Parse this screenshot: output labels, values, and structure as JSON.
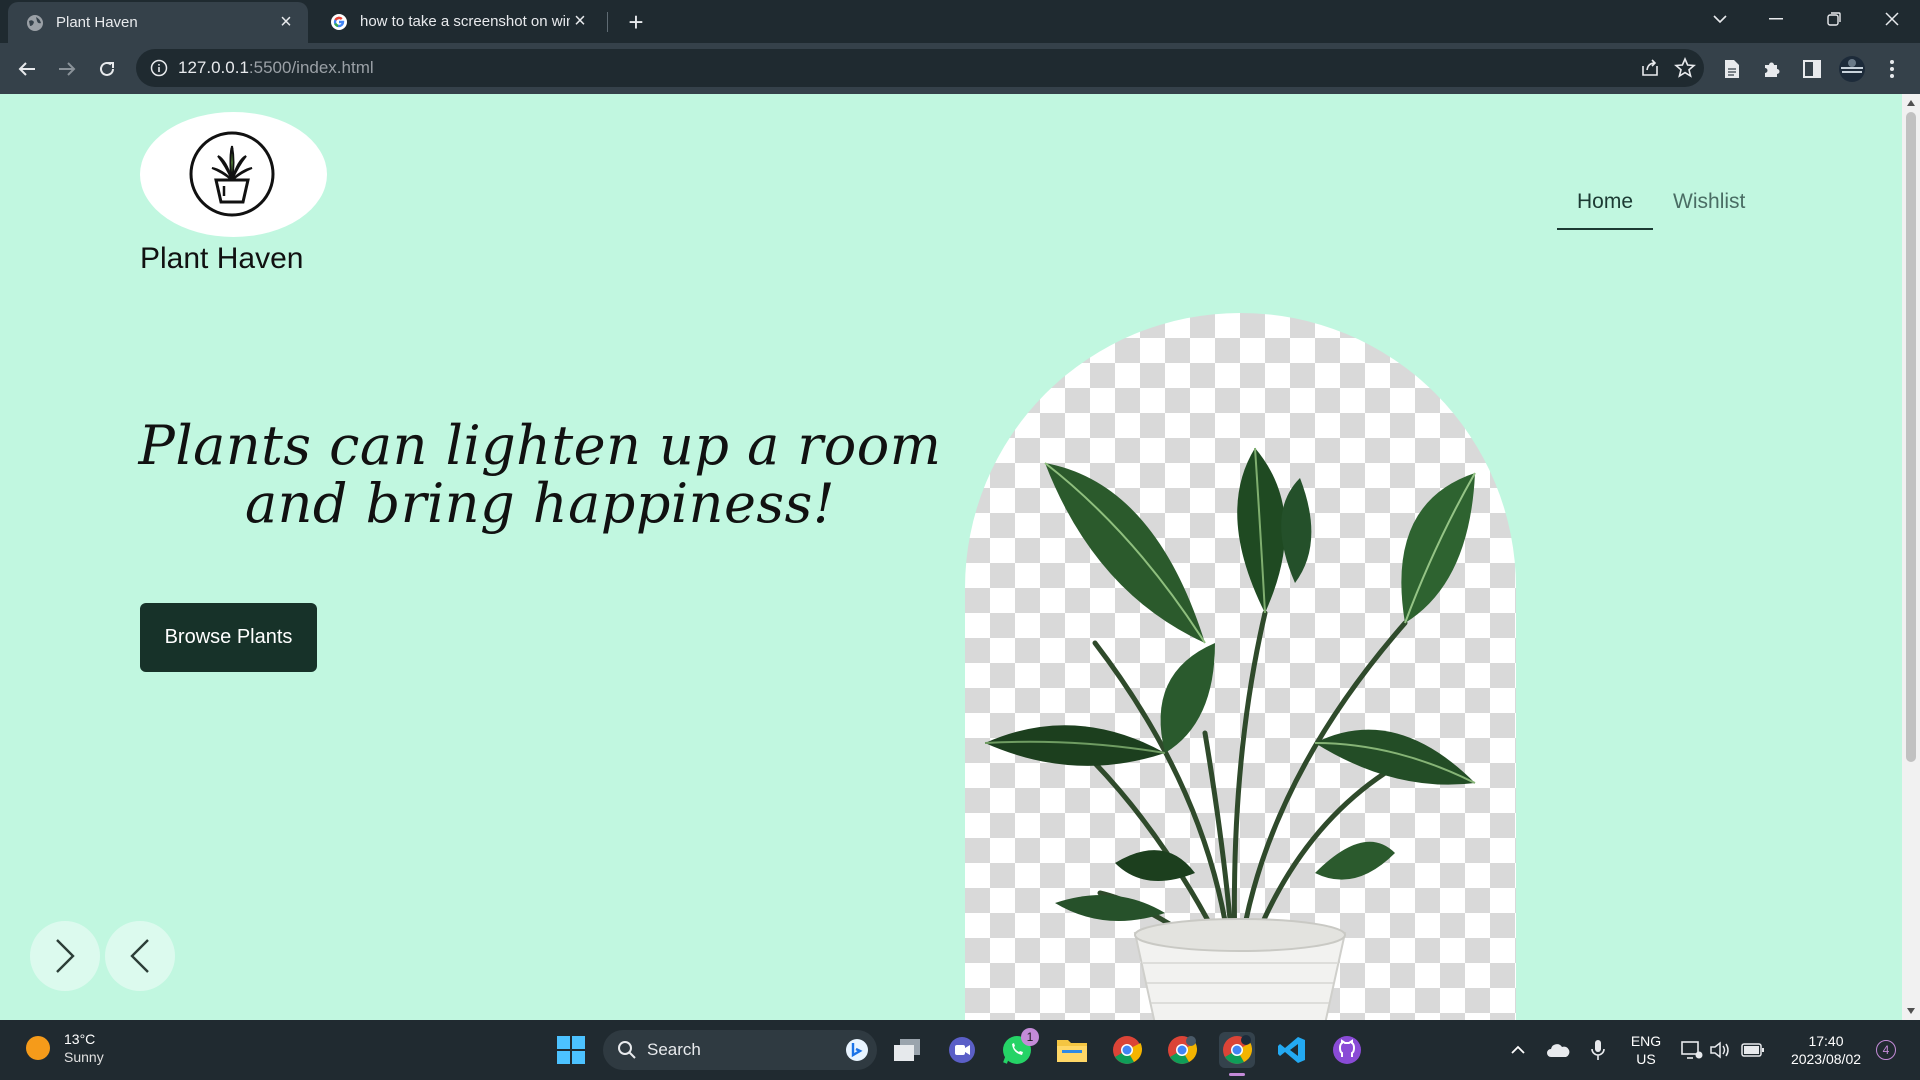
{
  "browser": {
    "tabs": [
      {
        "title": "Plant Haven",
        "active": true
      },
      {
        "title": "how to take a screenshot on windows",
        "active": false
      }
    ],
    "url_host": "127.0.0.1",
    "url_path": ":5500/index.html"
  },
  "site": {
    "brand": "Plant Haven",
    "nav": [
      {
        "label": "Home",
        "active": true
      },
      {
        "label": "Wishlist",
        "active": false
      }
    ],
    "hero_line1": "Plants can lighten up a room",
    "hero_line2": "and bring happiness!",
    "cta_label": "Browse Plants",
    "carousel_next_icon": "chevron-right-icon",
    "carousel_prev_icon": "chevron-left-icon"
  },
  "taskbar": {
    "weather_temp": "13°C",
    "weather_condition": "Sunny",
    "search_label": "Search",
    "whatsapp_badge": "1",
    "lang_top": "ENG",
    "lang_bottom": "US",
    "time": "17:40",
    "date": "2023/08/02",
    "notification_count": "4"
  },
  "colors": {
    "page_bg": "#c1f7e0",
    "button_bg": "#173229",
    "chrome_dark": "#1f2a30",
    "chrome_mid": "#35414a"
  }
}
